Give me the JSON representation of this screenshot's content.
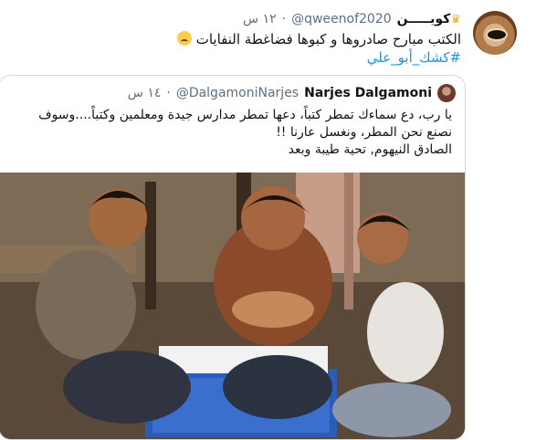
{
  "tweet": {
    "display_name": "كويـــــن",
    "crown_icon": "crown-icon",
    "handle": "@qweenof2020",
    "dot": "·",
    "time": "١٢ س",
    "text_line1": "الكتب مبارح صادروها و كبوها فضاغطة النفايات",
    "hashtag": "#كشك_أبو_علي",
    "emoji_icon": "crying-face-icon"
  },
  "quote": {
    "display_name": "Narjes Dalgamoni",
    "handle": "@DalgamoniNarjes",
    "dot": "·",
    "time": "١٤ س",
    "text_line1": "يا رب، دع سماءك تمطر كتباً، دعها تمطر مدارس جيدة ومعلمين وكتباً....وسوف",
    "text_line2": "نصنع نحن المطر، ونغسل عارنا !!",
    "text_line3": "الصادق النيهوم, تحية طيبة وبعد",
    "image_alt": "children reading books on a blue crate"
  }
}
